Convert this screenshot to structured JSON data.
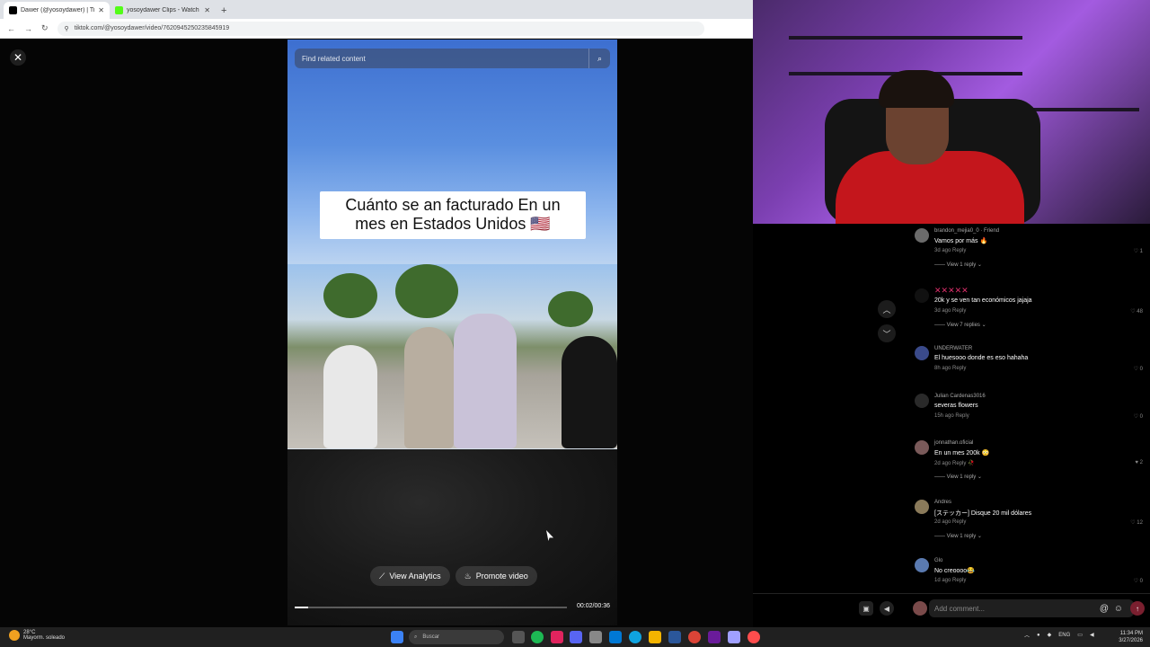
{
  "browser": {
    "tabs": [
      {
        "title": "Dawer (@yosoydawer) | TikTok",
        "active": true,
        "favicon_color": "#000000"
      },
      {
        "title": "yosoydawer Clips - Watch Live",
        "active": false,
        "favicon_color": "#53fc18"
      }
    ],
    "url": "tiktok.com/@yosoydawer/video/7620945250235845919"
  },
  "viewer": {
    "search_placeholder": "Find related content",
    "caption_line1": "Cuánto se an facturado En un",
    "caption_line2": "mes en Estados Unidos 🇺🇸",
    "view_analytics": "View Analytics",
    "promote_video": "Promote video",
    "time": "00:02/00:36",
    "progress": 0.05
  },
  "comments": [
    {
      "name": "brandon_mejia0_0 · Friend",
      "text": "Vamos por más 🔥",
      "meta": "3d ago   Reply",
      "likes": "♡ 1",
      "replies": "——  View 1 reply ⌄",
      "avatar": "#6b6b6b"
    },
    {
      "name": "✕✕✕✕✕",
      "text": "20k y se ven tan económicos jajaja",
      "meta": "3d ago   Reply",
      "likes": "♡ 48",
      "replies": "——  View 7 replies ⌄",
      "avatar": "#111111"
    },
    {
      "name": "UNDERWATER",
      "text": "El huesooo donde es eso hahaha",
      "meta": "8h ago   Reply",
      "likes": "♡ 0",
      "replies": "",
      "avatar": "#3a4a8a"
    },
    {
      "name": "Julian Cardenas3016",
      "text": "severas flowers",
      "meta": "15h ago   Reply",
      "likes": "♡ 0",
      "replies": "",
      "avatar": "#2a2a2a"
    },
    {
      "name": "jonnathan.oficial",
      "text": "En un mes 200k 😳",
      "meta": "2d ago   Reply   🥀",
      "likes": "♥ 2",
      "replies": "——  View 1 reply ⌄",
      "avatar": "#7a5a5a"
    },
    {
      "name": "Andres",
      "text": "[ステッカー] Disque 20 mil dólares",
      "meta": "2d ago   Reply",
      "likes": "♡ 12",
      "replies": "——  View 1 reply ⌄",
      "avatar": "#8a7a5a"
    },
    {
      "name": "Glo",
      "text": "No creoooo😂",
      "meta": "1d ago   Reply",
      "likes": "♡ 0",
      "replies": "",
      "avatar": "#5a7ab0"
    }
  ],
  "comment_bar": {
    "placeholder": "Add comment...",
    "at": "@",
    "emoji": "☺"
  },
  "taskbar": {
    "weather_temp": "28°C",
    "weather_desc": "Mayorm. soleado",
    "search": "Buscar",
    "lang": "ENG",
    "time": "11:34 PM",
    "date": "3/27/2026"
  }
}
